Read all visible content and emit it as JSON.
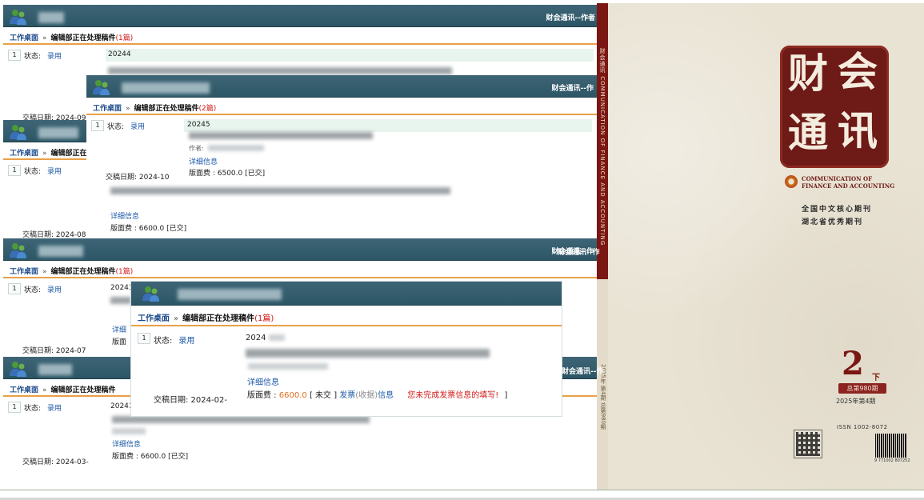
{
  "brand_full": "财会通讯--作者",
  "brand_short": "财会通讯--作",
  "brand_short2": "财会通讯--作",
  "brand_mid": "财会通讯--作",
  "brand_p5": "财会通讯--作",
  "breadcrumb": {
    "home": "工作桌面",
    "separator": "»",
    "current": "编辑部正在处理稿件",
    "count_1": "(1篇)",
    "count_2": "(2篇)"
  },
  "status_label": "状态:",
  "status_value": "录用",
  "detail_link": "详细信息",
  "author_label": "作者:",
  "panels": [
    {
      "row_num": "1",
      "id_prefix": "20244",
      "date": "交稿日期: 2024-09"
    },
    {
      "row_num": "1",
      "id_prefix": "20245",
      "date": "交稿日期: 2024-10",
      "fee": "版面费 : 6500.0  [已交]"
    },
    {
      "row_num": "1",
      "date": "交稿日期: 2024-08-",
      "fee": "版面费 : 6600.0  [已交]"
    },
    {
      "row_num": "1",
      "id_prefix": "20243",
      "date": "交稿日期: 2024-07",
      "detail": "详细",
      "fee_part": "版面"
    },
    {
      "row_num": "1",
      "id_prefix": "2024",
      "date": "交稿日期: 2024-02-",
      "fee_label": "版面费 :",
      "fee_value": "6600.0",
      "fee_unpaid": "[ 未交 ]",
      "invoice": "发票",
      "invoice_collect": "(收据)",
      "invoice_info": "信息",
      "invoice_warning": "您未完成发票信息的填写!",
      "close_bracket": "]"
    },
    {
      "row_num": "1",
      "id_prefix": "20241",
      "date": "交稿日期: 2024-03-",
      "fee": "版面费 : 6600.0  [已交]"
    }
  ],
  "cover": {
    "title_chars": [
      "财",
      "会",
      "通",
      "讯"
    ],
    "english_title_line1": "COMMUNICATION OF",
    "english_title_line2": "FINANCE AND ACCOUNTING",
    "subtitle_1": "全国中文核心期刊",
    "subtitle_2": "湖北省优秀期刊",
    "issue_number": "2",
    "issue_half": "下",
    "total_issue": "总第980期",
    "year_issue": "2025年第4期",
    "issn": "ISSN 1002-8072",
    "barcode_digits": "9 771002 807252",
    "spine_text": "财会通讯 COMMUNICATION OF FINANCE AND ACCOUNTING",
    "spine_lower_text": "2025年 第4期 总第980期"
  },
  "colors": {
    "header_bg": "#2c5666",
    "link": "#1e5aa8",
    "count_red": "#d21a1a",
    "fee_orange": "#e07020",
    "crumb_rule": "#e8a048",
    "cover_red": "#6e1a16"
  }
}
